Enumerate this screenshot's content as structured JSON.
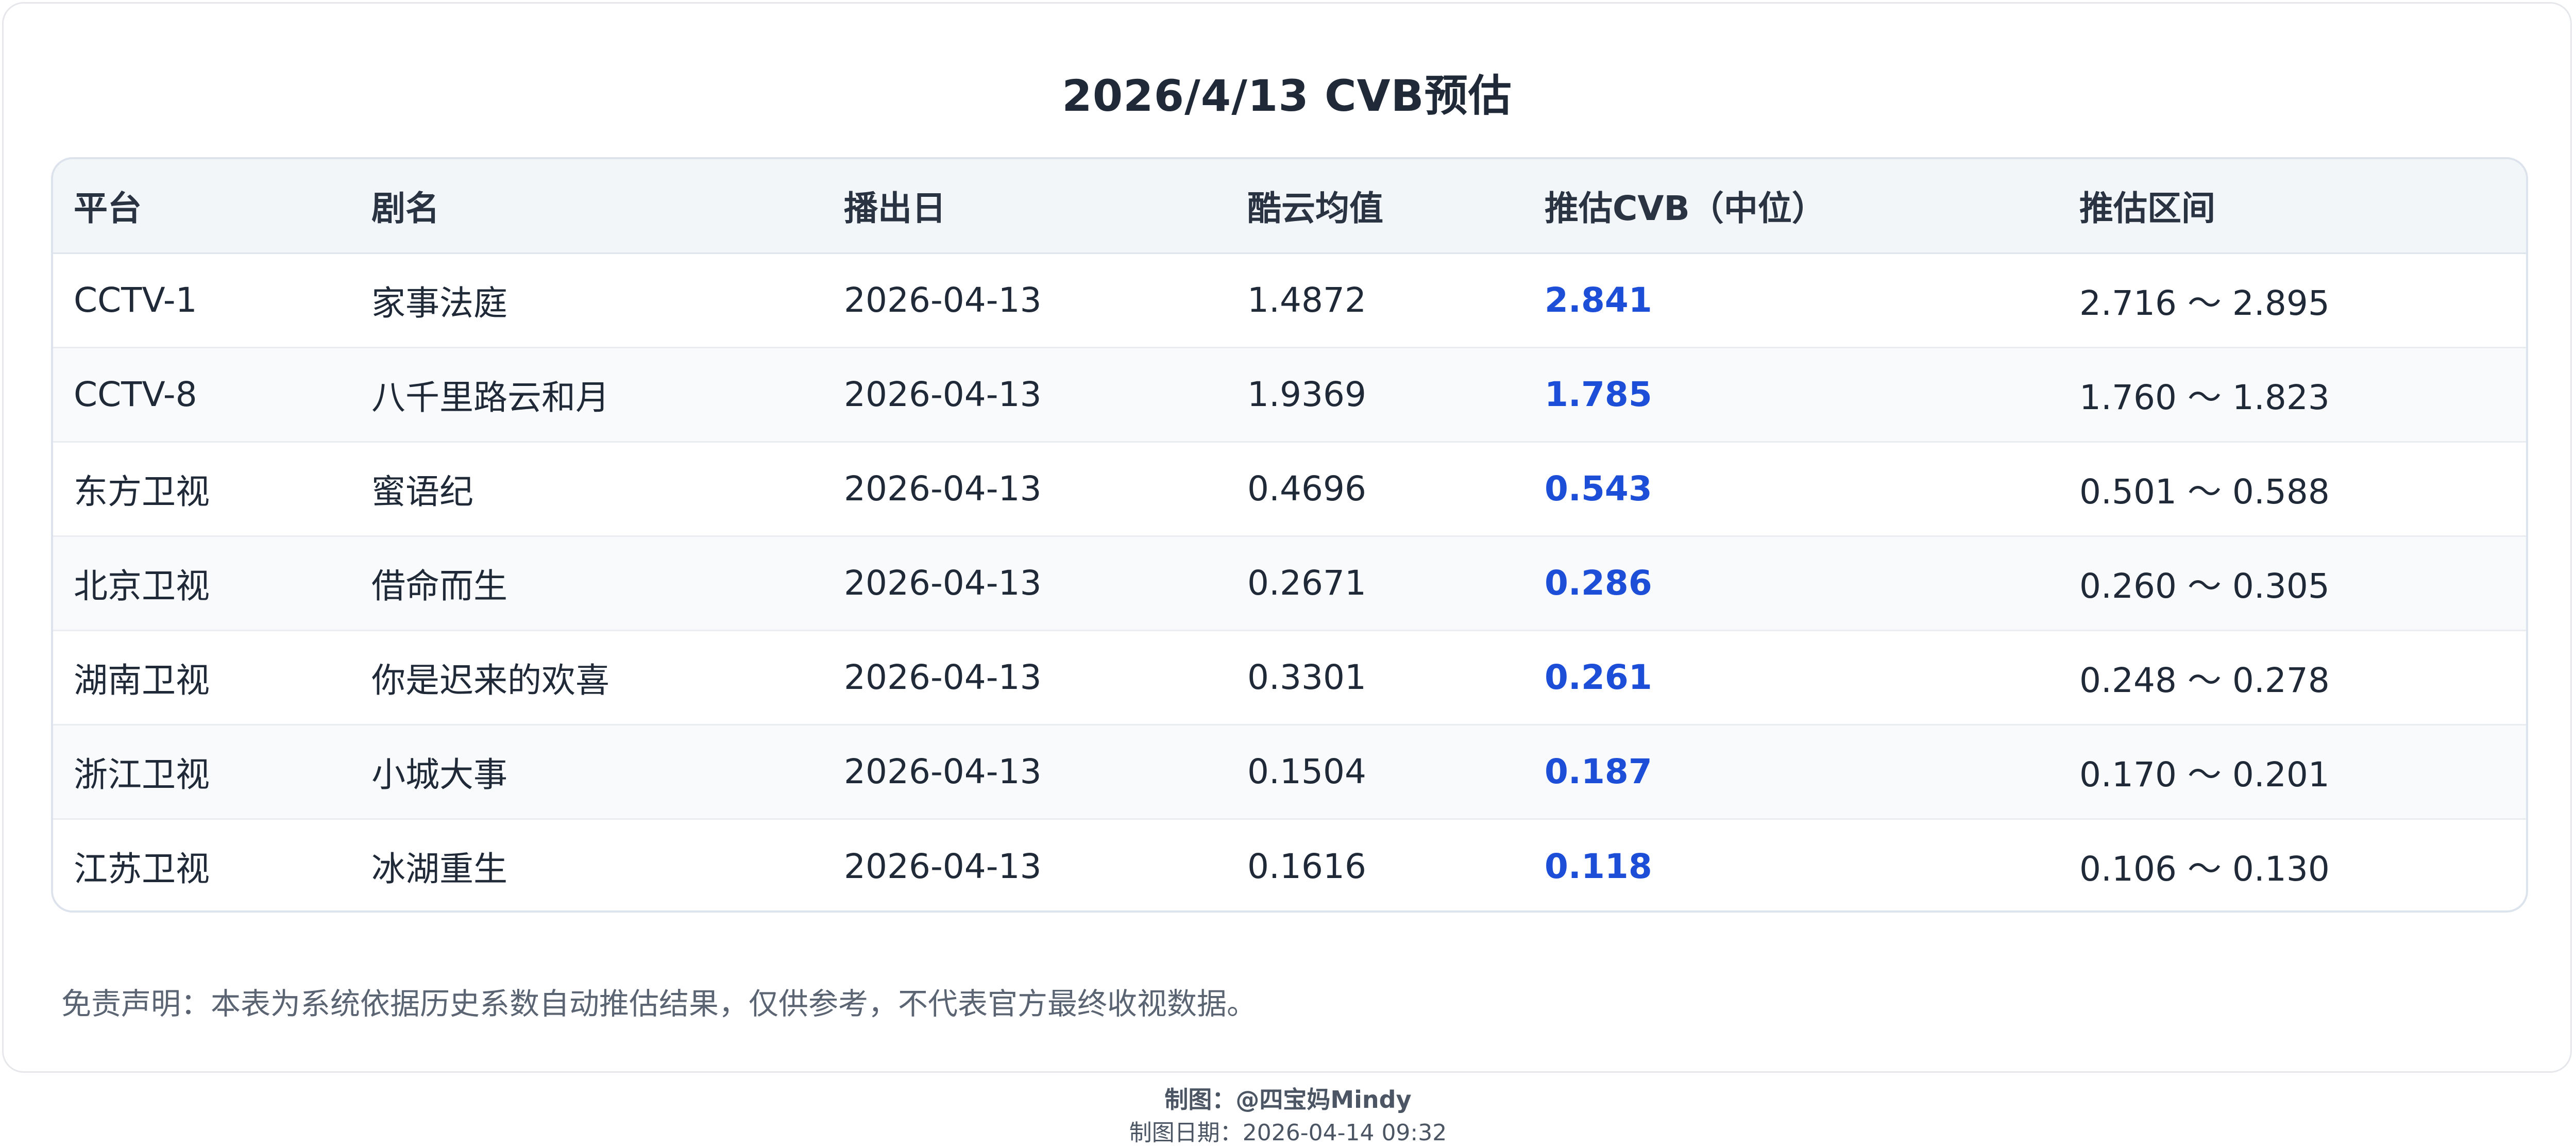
{
  "title": "2026/4/13 CVB预估",
  "table": {
    "columns": [
      "平台",
      "剧名",
      "播出日",
      "酷云均值",
      "推估CVB（中位）",
      "推估区间"
    ],
    "rows": [
      [
        "CCTV-1",
        "家事法庭",
        "2026-04-13",
        "1.4872",
        "2.841",
        "2.716 ～ 2.895"
      ],
      [
        "CCTV-8",
        "八千里路云和月",
        "2026-04-13",
        "1.9369",
        "1.785",
        "1.760 ～ 1.823"
      ],
      [
        "东方卫视",
        "蜜语纪",
        "2026-04-13",
        "0.4696",
        "0.543",
        "0.501 ～ 0.588"
      ],
      [
        "北京卫视",
        "借命而生",
        "2026-04-13",
        "0.2671",
        "0.286",
        "0.260 ～ 0.305"
      ],
      [
        "湖南卫视",
        "你是迟来的欢喜",
        "2026-04-13",
        "0.3301",
        "0.261",
        "0.248 ～ 0.278"
      ],
      [
        "浙江卫视",
        "小城大事",
        "2026-04-13",
        "0.1504",
        "0.187",
        "0.170 ～ 0.201"
      ],
      [
        "江苏卫视",
        "冰湖重生",
        "2026-04-13",
        "0.1616",
        "0.118",
        "0.106 ～ 0.130"
      ]
    ]
  },
  "disclaimer": "免责声明：本表为系统依据历史系数自动推估结果，仅供参考，不代表官方最终收视数据。",
  "credit": "制图：@四宝妈Mindy",
  "credit_date": "制图日期：2026-04-14 09:32",
  "colors": {
    "accent_value": "#1d4ed8",
    "header_bg": "#f3f6f9",
    "stripe_bg": "#f8fafc",
    "border": "#dde3ec"
  }
}
